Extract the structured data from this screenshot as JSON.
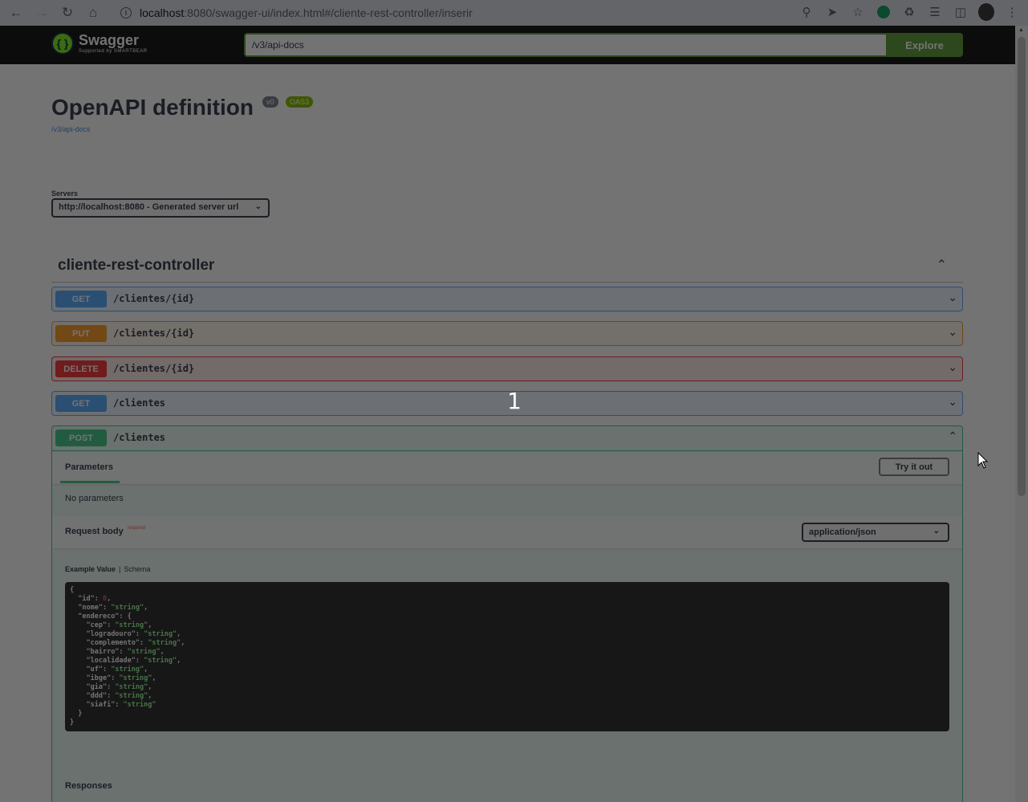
{
  "browser": {
    "url_host": "localhost",
    "url_path": ":8080/swagger-ui/index.html#/cliente-rest-controller/inserir"
  },
  "topbar": {
    "logo_name": "Swagger",
    "logo_by": "Supported by SMARTBEAR",
    "url_value": "/v3/api-docs",
    "explore_label": "Explore"
  },
  "info": {
    "title": "OpenAPI definition",
    "version_badge": "v0",
    "oas_badge": "OAS3",
    "spec_url": "/v3/api-docs"
  },
  "servers": {
    "label": "Servers",
    "selected": "http://localhost:8080 - Generated server url"
  },
  "tag": {
    "title": "cliente-rest-controller"
  },
  "operations": [
    {
      "method": "GET",
      "path": "/clientes/{id}"
    },
    {
      "method": "PUT",
      "path": "/clientes/{id}"
    },
    {
      "method": "DELETE",
      "path": "/clientes/{id}"
    },
    {
      "method": "GET",
      "path": "/clientes"
    }
  ],
  "post_op": {
    "method": "POST",
    "path": "/clientes",
    "parameters_tab": "Parameters",
    "try_it_out": "Try it out",
    "no_parameters": "No parameters",
    "request_body_label": "Request body",
    "required_label": "required",
    "content_type": "application/json",
    "example_tab": "Example Value",
    "schema_tab": "Schema",
    "responses_label": "Responses"
  },
  "example_json": [
    {
      "indent": 0,
      "text": "{"
    },
    {
      "indent": 1,
      "key": "\"id\"",
      "num": "0",
      "tail": ","
    },
    {
      "indent": 1,
      "key": "\"nome\"",
      "str": "\"string\"",
      "tail": ","
    },
    {
      "indent": 1,
      "key": "\"endereco\"",
      "raw": "{"
    },
    {
      "indent": 2,
      "key": "\"cep\"",
      "str": "\"string\"",
      "tail": ","
    },
    {
      "indent": 2,
      "key": "\"logradouro\"",
      "str": "\"string\"",
      "tail": ","
    },
    {
      "indent": 2,
      "key": "\"complemento\"",
      "str": "\"string\"",
      "tail": ","
    },
    {
      "indent": 2,
      "key": "\"bairro\"",
      "str": "\"string\"",
      "tail": ","
    },
    {
      "indent": 2,
      "key": "\"localidade\"",
      "str": "\"string\"",
      "tail": ","
    },
    {
      "indent": 2,
      "key": "\"uf\"",
      "str": "\"string\"",
      "tail": ","
    },
    {
      "indent": 2,
      "key": "\"ibge\"",
      "str": "\"string\"",
      "tail": ","
    },
    {
      "indent": 2,
      "key": "\"gia\"",
      "str": "\"string\"",
      "tail": ","
    },
    {
      "indent": 2,
      "key": "\"ddd\"",
      "str": "\"string\"",
      "tail": ","
    },
    {
      "indent": 2,
      "key": "\"siafi\"",
      "str": "\"string\""
    },
    {
      "indent": 1,
      "text": "}"
    },
    {
      "indent": 0,
      "text": "}"
    }
  ],
  "overlay_step": "1",
  "colors": {
    "get": "#61affe",
    "put": "#fca130",
    "delete": "#f93e3e",
    "post": "#49cc90",
    "explore": "#62a03f"
  },
  "icons": {
    "back": "arrow-left-icon",
    "forward": "arrow-right-icon",
    "reload": "reload-icon",
    "home": "home-icon",
    "chevron": "chevron-down-icon"
  }
}
